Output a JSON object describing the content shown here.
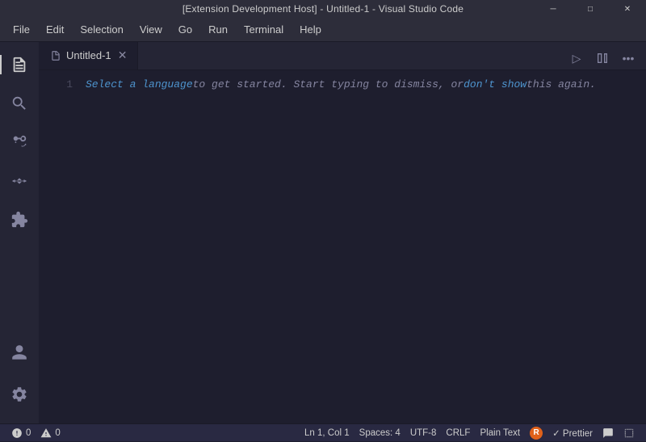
{
  "titleBar": {
    "title": "[Extension Development Host] - Untitled-1 - Visual Studio Code",
    "minimize": "─",
    "maximize": "□",
    "close": "✕"
  },
  "menuBar": {
    "items": [
      "File",
      "Edit",
      "Selection",
      "View",
      "Go",
      "Run",
      "Terminal",
      "Help"
    ]
  },
  "activityBar": {
    "icons": [
      {
        "name": "files-icon",
        "symbol": "⊞",
        "active": true
      },
      {
        "name": "search-icon",
        "symbol": "🔍"
      },
      {
        "name": "source-control-icon",
        "symbol": "⑂"
      },
      {
        "name": "run-debug-icon",
        "symbol": "▷"
      },
      {
        "name": "extensions-icon",
        "symbol": "⊞"
      }
    ],
    "bottomIcons": [
      {
        "name": "account-icon",
        "symbol": "👤"
      },
      {
        "name": "settings-icon",
        "symbol": "⚙"
      }
    ]
  },
  "tabs": [
    {
      "label": "Untitled-1",
      "active": true,
      "dirty": false
    }
  ],
  "toolbar": {
    "run_label": "▷",
    "split_label": "⊟",
    "more_label": "…"
  },
  "editor": {
    "lineNumbers": [
      "1"
    ],
    "codeLine": {
      "selectLanguage": "Select a language",
      "textMiddle": " to get started. Start typing to dismiss, or ",
      "dontShow": "don't show",
      "textEnd": " this again."
    }
  },
  "statusBar": {
    "errors": "0",
    "warnings": "0",
    "position": "Ln 1, Col 1",
    "spaces": "Spaces: 4",
    "encoding": "UTF-8",
    "lineEnding": "CRLF",
    "language": "Plain Text",
    "prettier": "✓ Prettier",
    "feedback": "🔔",
    "layout": "⊟"
  }
}
